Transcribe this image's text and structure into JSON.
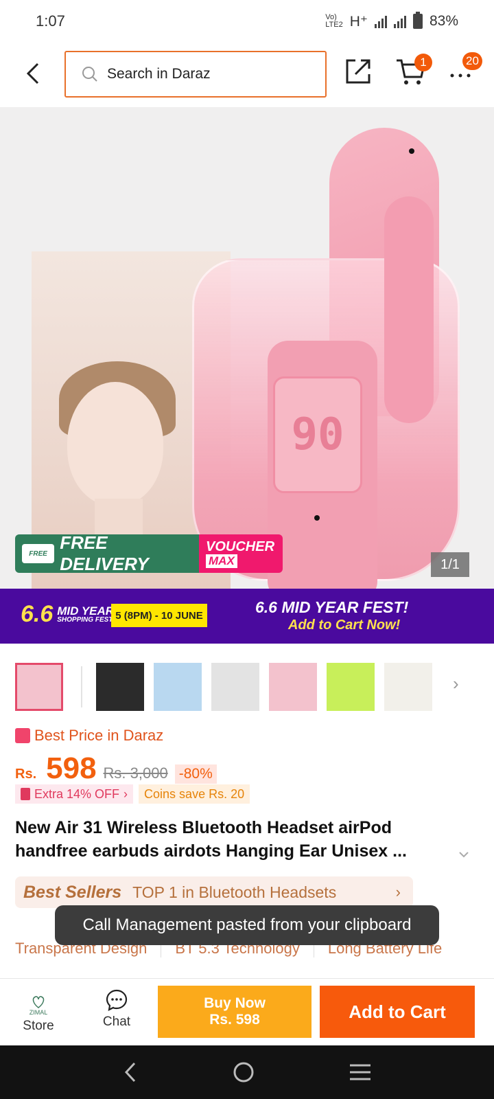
{
  "status_bar": {
    "time": "1:07",
    "network": "H⁺",
    "volte": "VoLTE2",
    "battery": "83%"
  },
  "header": {
    "search_placeholder": "Search in Daraz",
    "cart_badge": "1",
    "more_badge": "20"
  },
  "hero": {
    "display_digits": "90",
    "delivery_label": "FREE DELIVERY",
    "free_tag": "FREE",
    "voucher_line1": "VOUCHER",
    "voucher_line2": "MAX",
    "image_counter": "1/1"
  },
  "promo": {
    "logo_big": "6.6",
    "logo_line1": "MID YEAR",
    "logo_line2": "SHOPPING FEST!",
    "date": "5 (8PM) - 10 JUNE",
    "title": "6.6 MID YEAR FEST!",
    "subtitle": "Add to Cart Now!"
  },
  "thumbnails": {
    "colors": [
      "#f3c2cd",
      "#2b2b2b",
      "#b9d8f0",
      "#e3e3e3",
      "#f3c2cd",
      "#c8ef5a",
      "#f2f0ea"
    ]
  },
  "price": {
    "best_label": "Best Price in Daraz",
    "currency": "Rs.",
    "value": "598",
    "original": "Rs. 3,000",
    "discount": "-80%",
    "extra_off": "Extra 14% OFF",
    "coins": "Coins save Rs. 20"
  },
  "product": {
    "title": "New Air 31 Wireless Bluetooth Headset airPod handfree earbuds airdots Hanging Ear Unisex ..."
  },
  "bestseller": {
    "badge": "Best Sellers",
    "text": "TOP 1 in Bluetooth Headsets"
  },
  "features": [
    "Transparent Design",
    "BT 5.3 Technology",
    "Long Battery Life"
  ],
  "toast": {
    "message": "Call Management pasted from your clipboard"
  },
  "action_bar": {
    "store_label": "Store",
    "store_logo_text": "ZIMAL",
    "chat_label": "Chat",
    "buy_now_line1": "Buy Now",
    "buy_now_line2": "Rs. 598",
    "add_to_cart": "Add to Cart"
  },
  "colors": {
    "accent": "#f75a0c",
    "buy_now": "#fbaa1b",
    "promo_bg": "#4a0a9e",
    "delivery_green": "#2f7d5a",
    "voucher_pink": "#f0196d"
  }
}
